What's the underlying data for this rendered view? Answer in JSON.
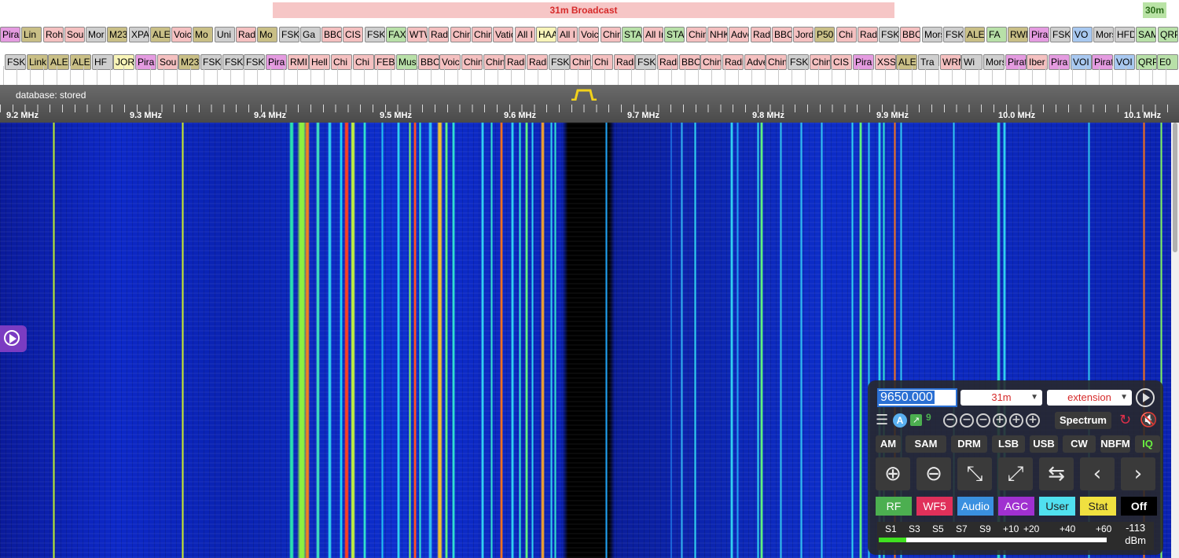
{
  "band": {
    "title": "31m Broadcast",
    "tag": "30m"
  },
  "labels_row1": [
    "Pira",
    "Lin",
    "Roh",
    "Sour",
    "Mor",
    "M23",
    "XPA",
    "ALE",
    "Voic",
    "Mo",
    "Uni",
    "Radi",
    "Mo",
    "FSK",
    "Ga",
    "BBC",
    "CIS",
    "FSK",
    "FAX",
    "WTWW",
    "Radi",
    "China",
    "China",
    "Vatic",
    "All I",
    "HAAR",
    "All I",
    "Voice",
    "Chin",
    "STA",
    "All In",
    "STAN",
    "China",
    "NHK",
    "Adve",
    "Radi",
    "BBC",
    "Jord",
    "P50",
    "Chi",
    "Radi",
    "FSK",
    "BBC",
    "Mors",
    "FSK",
    "ALE",
    "FA",
    "RWM",
    "Pira",
    "FSK",
    "VO",
    "Mors",
    "HFD",
    "SAM",
    "QRP"
  ],
  "labels_row2": [
    "FSK",
    "Link",
    "ALE",
    "ALE",
    "HF",
    "JOR",
    "Pira",
    "Sou",
    "M23",
    "FSK",
    "FSK",
    "FSK",
    "Pira",
    "RMI",
    "Hell",
    "Chi",
    "Chi",
    "FEBC",
    "Music",
    "BBC",
    "Voice",
    "Chin",
    "China",
    "Radi",
    "Radi",
    "FSK",
    "China",
    "Chi",
    "Radi",
    "FSK",
    "Radi",
    "BBC",
    "Chin",
    "Radi",
    "Adve",
    "Chin",
    "FSK",
    "Chin",
    "CIS",
    "Pira",
    "XSS",
    "ALE",
    "Tra",
    "WRM",
    "Wi",
    "Morse",
    "Pirat",
    "Iber",
    "Pira",
    "VOI",
    "Pirat",
    "VOI",
    "QRP",
    "E0"
  ],
  "scale": {
    "db_label": "database: stored",
    "mhz": [
      "9.2 MHz",
      "9.3 MHz",
      "9.4 MHz",
      "9.5 MHz",
      "9.6 MHz",
      "9.7 MHz",
      "9.8 MHz",
      "9.9 MHz",
      "10.0 MHz",
      "10.1 MHz"
    ]
  },
  "panel": {
    "frequency": "9650.000",
    "band_select": "31m",
    "extension_select": "extension",
    "spectrum_label": "Spectrum",
    "badge_a": "A",
    "badge_num": "9",
    "modes": [
      "AM",
      "SAM",
      "DRM",
      "LSB",
      "USB",
      "CW",
      "NBFM",
      "IQ"
    ],
    "tabs": [
      "RF",
      "WF5",
      "Audio",
      "AGC",
      "User",
      "Stat",
      "Off"
    ],
    "smeter": {
      "scale": [
        "S1",
        "S3",
        "S5",
        "S7",
        "S9",
        "+10",
        "+20",
        "+40",
        "+60"
      ],
      "dbm_value": "-113",
      "dbm_unit": "dBm",
      "level": 0.12
    }
  },
  "colors": {
    "accent_blue": "#2a6fd3",
    "band_bar": "#f6c6c6",
    "band_text": "#d62a2a"
  }
}
